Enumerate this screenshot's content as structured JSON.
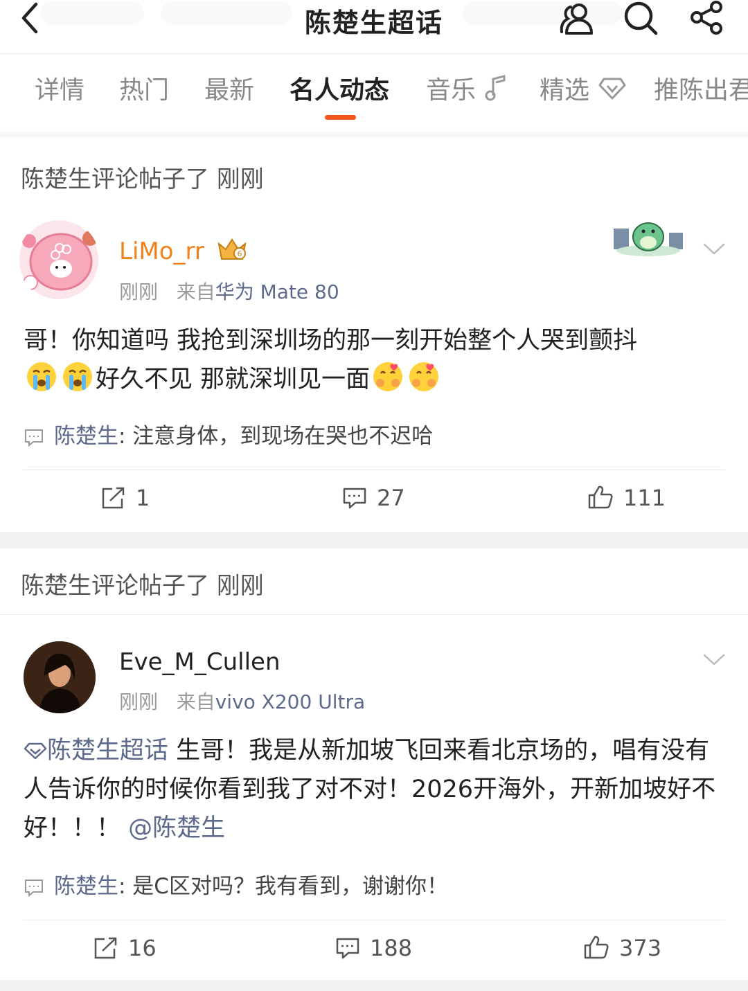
{
  "header": {
    "title": "陈楚生超话"
  },
  "tabs": [
    {
      "label": "详情"
    },
    {
      "label": "热门"
    },
    {
      "label": "最新"
    },
    {
      "label": "名人动态"
    },
    {
      "label": "音乐"
    },
    {
      "label": "精选"
    },
    {
      "label": "推陈出君"
    }
  ],
  "posts": [
    {
      "section_label": "陈楚生评论帖子了 刚刚",
      "username": "LiMo_rr",
      "time": "刚刚",
      "from_prefix": "来自",
      "device": "华为 Mate 80",
      "text_1": "哥！你知道吗 我抢到深圳场的那一刻开始整个人哭到颤抖",
      "text_2": "好久不见 那就深圳见一面",
      "reply_author": "陈楚生",
      "reply_text": ": 注意身体，到现场在哭也不迟哈",
      "reposts": "1",
      "comments": "27",
      "likes": "111"
    },
    {
      "section_label": "陈楚生评论帖子了 刚刚",
      "username": "Eve_M_Cullen",
      "time": "刚刚",
      "from_prefix": "来自",
      "device": "vivo X200 Ultra",
      "topic_link": "陈楚生超话",
      "text_1": " 生哥！我是从新加坡飞回来看北京场的，唱有没有人告诉你的时候你看到我了对不对！2026开海外，开新加坡好不好！！！ ",
      "mention": "@陈楚生",
      "reply_author": "陈楚生",
      "reply_text": ": 是C区对吗？我有看到，谢谢你！",
      "reposts": "16",
      "comments": "188",
      "likes": "373"
    }
  ],
  "colors": {
    "accent": "#f5561d",
    "username_vip": "#f0821e",
    "link": "#5d6a8c"
  }
}
